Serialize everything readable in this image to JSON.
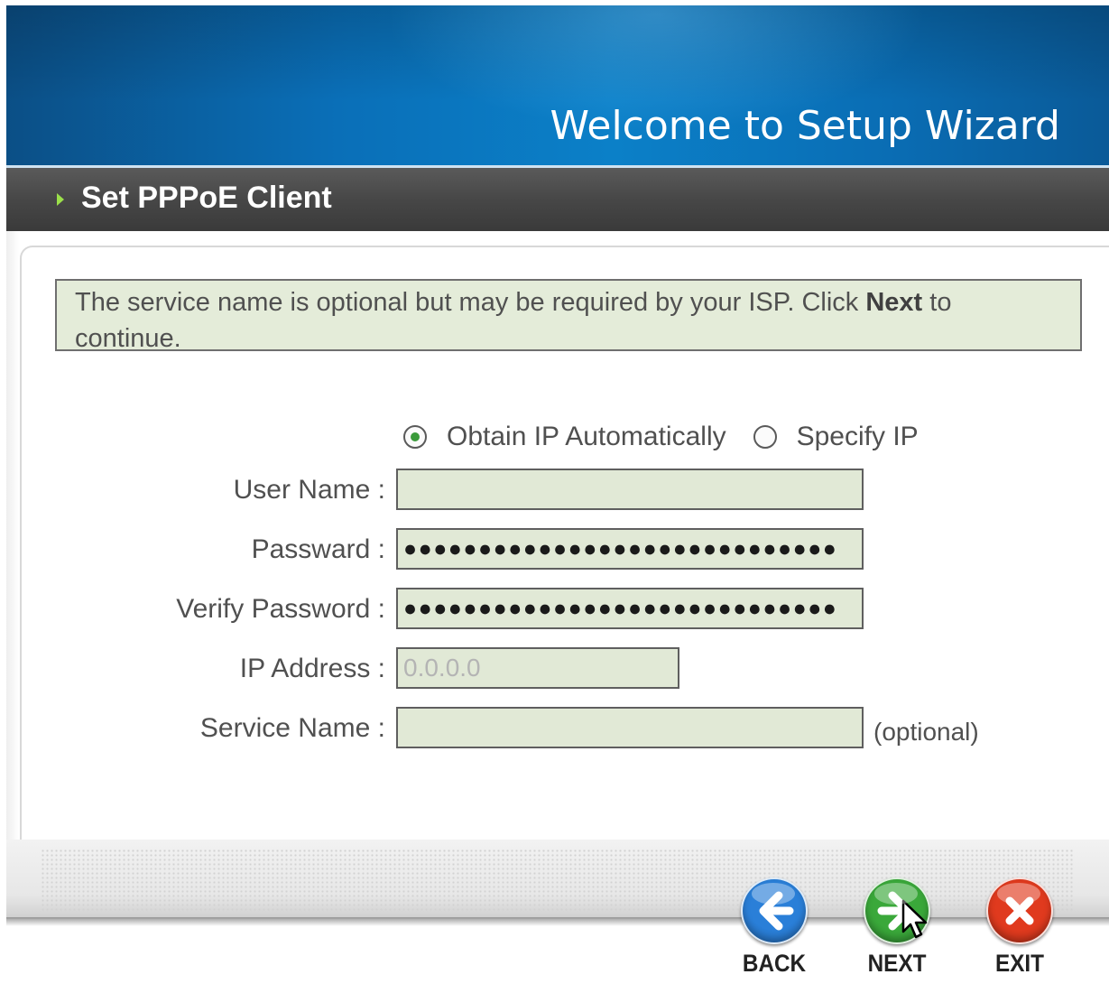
{
  "header": {
    "title": "Welcome to Setup Wizard"
  },
  "section": {
    "title": "Set PPPoE Client"
  },
  "notice": {
    "text_before": "The service name is optional but may be required by your ISP. Click ",
    "bold": "Next",
    "text_after": " to continue."
  },
  "ip_mode": {
    "options": [
      {
        "label": "Obtain IP Automatically",
        "selected": true
      },
      {
        "label": "Specify IP",
        "selected": false
      }
    ]
  },
  "form": {
    "user_name": {
      "label": "User Name :",
      "value": ""
    },
    "password": {
      "label": "Passward :",
      "value": "●●●●●●●●●●●●●●●●●●●●●●●●●●●●●"
    },
    "verify_password": {
      "label": "Verify Password :",
      "value": "●●●●●●●●●●●●●●●●●●●●●●●●●●●●●"
    },
    "ip_address": {
      "label": "IP Address :",
      "value": "0.0.0.0"
    },
    "service_name": {
      "label": "Service Name :",
      "value": "",
      "hint": "(optional)"
    }
  },
  "buttons": {
    "back": {
      "label": "BACK",
      "icon": "arrow-left-icon",
      "color": "#2a7fd8"
    },
    "next": {
      "label": "NEXT",
      "icon": "arrow-right-icon",
      "color": "#3aa83a"
    },
    "exit": {
      "label": "EXIT",
      "icon": "close-icon",
      "color": "#e03a1e"
    }
  }
}
